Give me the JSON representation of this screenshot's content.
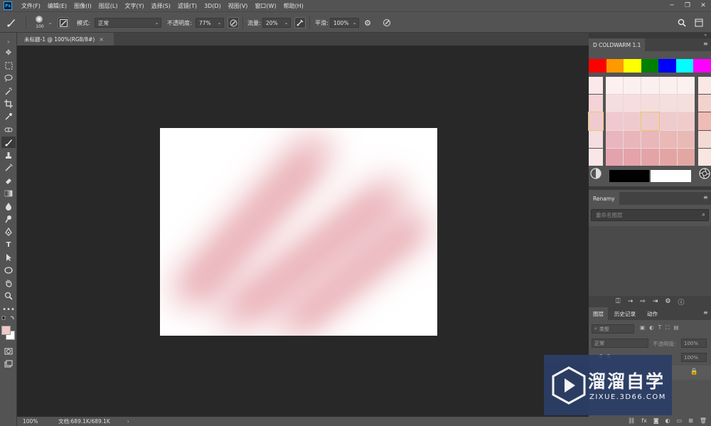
{
  "menubar": {
    "logo": "Ps",
    "items": [
      "文件(F)",
      "编辑(E)",
      "图像(I)",
      "图层(L)",
      "文字(Y)",
      "选择(S)",
      "滤镜(T)",
      "3D(D)",
      "视图(V)",
      "窗口(W)",
      "帮助(H)"
    ],
    "window_controls": [
      "─",
      "❐",
      "✕"
    ]
  },
  "options": {
    "brush_size": "100",
    "mode_label": "模式:",
    "mode_value": "正常",
    "opacity_label": "不透明度:",
    "opacity_value": "77%",
    "flow_label": "流量:",
    "flow_value": "20%",
    "smoothing_label": "平滑:",
    "smoothing_value": "100%"
  },
  "document": {
    "tab_title": "未标题-1 @ 100%(RGB/8#)",
    "tab_close": "×"
  },
  "statusbar": {
    "zoom": "100%",
    "doc_info": "文档:689.1K/689.1K",
    "arrow": "›"
  },
  "panels": {
    "coldwarm_title": "D COLDWARM 1.1",
    "renamy_title": "Renamy",
    "search_placeholder": "重命名图层",
    "layers_tab": "图层",
    "history_tab": "历史记录",
    "actions_tab": "动作",
    "filter_kind": "类型",
    "blend_mode": "正常",
    "opacity_label": "不透明度:",
    "opacity_value": "100%",
    "fill_value": "100%"
  },
  "colors": {
    "top_swatches": [
      "#ff0000",
      "#ff9900",
      "#ffff00",
      "#008000",
      "#0000ff",
      "#00ffff",
      "#ff00ff"
    ],
    "foreground": "#f0c8c8",
    "background": "#ffffff",
    "stroke_color": "#eab3b9"
  },
  "watermark": {
    "title": "溜溜自学",
    "subtitle": "ZIXUE.3D66.COM"
  }
}
